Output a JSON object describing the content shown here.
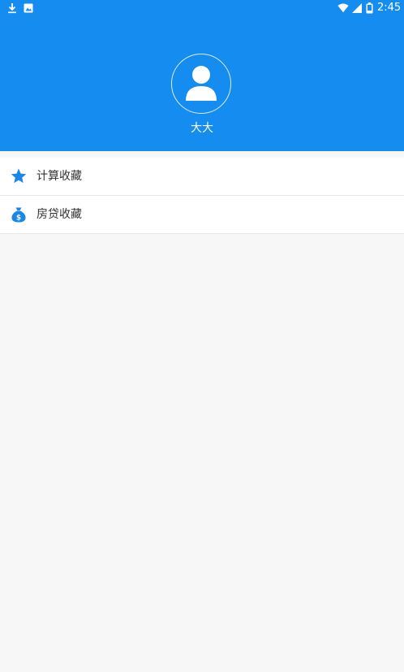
{
  "status_bar": {
    "time": "2:45",
    "icons": [
      "download-icon",
      "gallery-icon",
      "wifi-icon",
      "signal-icon",
      "battery-icon"
    ]
  },
  "profile": {
    "username": "大大",
    "avatar_icon": "user-avatar-icon"
  },
  "menu": {
    "items": [
      {
        "label": "计算收藏",
        "icon": "star-icon"
      },
      {
        "label": "房贷收藏",
        "icon": "money-bag-icon"
      }
    ]
  },
  "colors": {
    "header": "#148cf0",
    "icon_blue": "#1a86e6",
    "background": "#f7f7f7"
  }
}
